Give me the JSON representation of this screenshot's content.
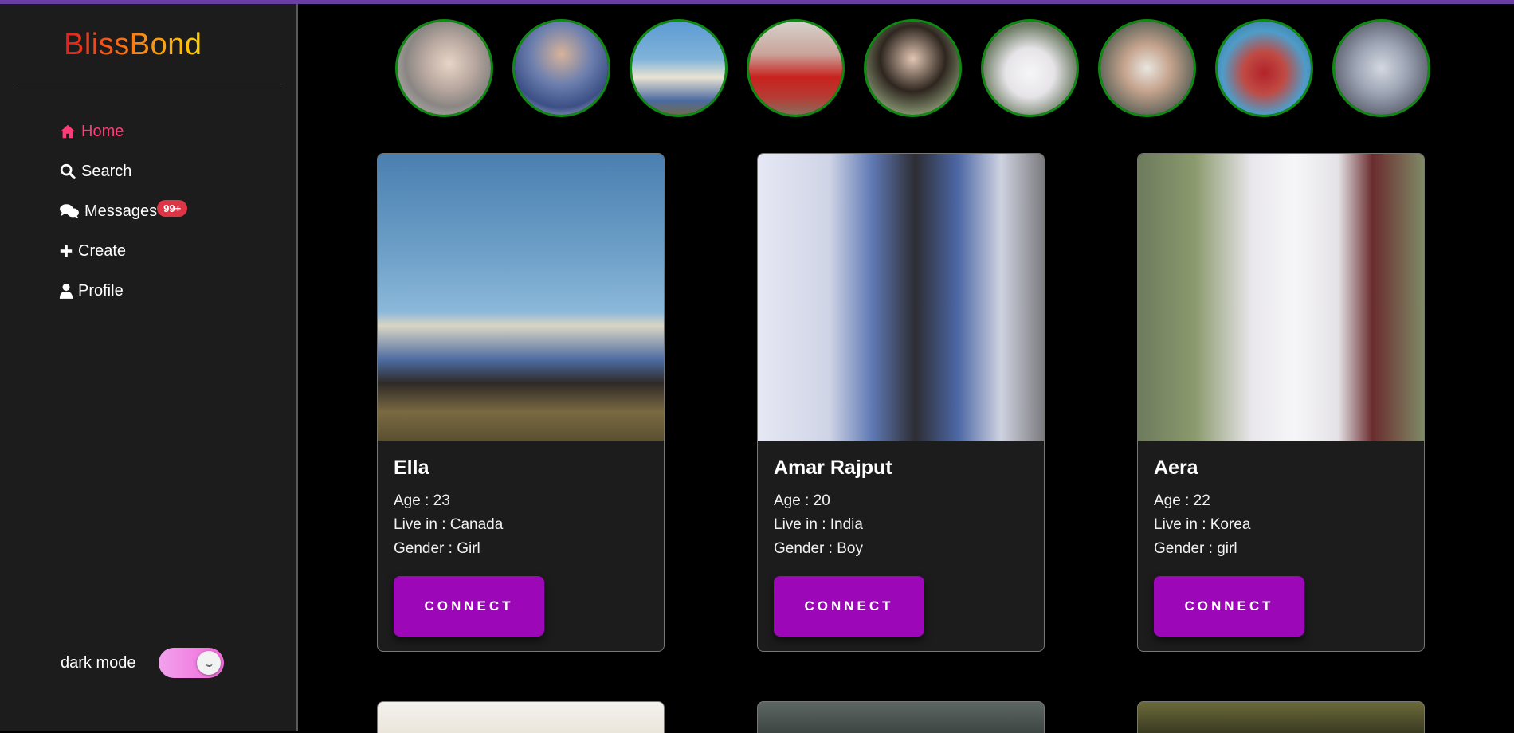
{
  "app": {
    "logo": "BlissBond"
  },
  "sidebar": {
    "items": [
      {
        "label": "Home",
        "icon": "home-icon",
        "active": true
      },
      {
        "label": "Search",
        "icon": "search-icon",
        "active": false
      },
      {
        "label": "Messages",
        "icon": "chat-icon",
        "active": false,
        "badge": "99+"
      },
      {
        "label": "Create",
        "icon": "plus-icon",
        "active": false
      },
      {
        "label": "Profile",
        "icon": "user-icon",
        "active": false
      }
    ],
    "dark_mode_label": "dark mode",
    "dark_mode_on": true
  },
  "colors": {
    "accent": "#ff3c78",
    "connect_button": "#9c08b8",
    "story_ring": "#0f8a12",
    "badge": "#dc3545"
  },
  "stories": [
    {
      "name": "story-1"
    },
    {
      "name": "story-2"
    },
    {
      "name": "story-3"
    },
    {
      "name": "story-4"
    },
    {
      "name": "story-5"
    },
    {
      "name": "story-6"
    },
    {
      "name": "story-7"
    },
    {
      "name": "story-8"
    },
    {
      "name": "story-9"
    }
  ],
  "cards": [
    {
      "name": "Ella",
      "age": "Age : 23",
      "live": "Live in : Canada",
      "gender": "Gender : Girl",
      "button": "CONNECT"
    },
    {
      "name": "Amar Rajput",
      "age": "Age : 20",
      "live": "Live in : India",
      "gender": "Gender : Boy",
      "button": "CONNECT"
    },
    {
      "name": "Aera",
      "age": "Age : 22",
      "live": "Live in : Korea",
      "gender": "Gender : girl",
      "button": "CONNECT"
    }
  ]
}
